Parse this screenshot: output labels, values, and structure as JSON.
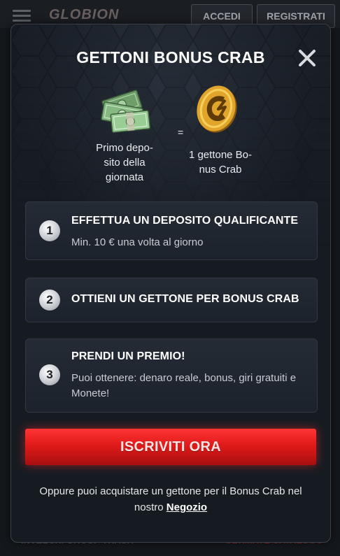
{
  "background": {
    "logo": "GLOBION",
    "login_label": "ACCEDI",
    "register_label": "REGISTRATI",
    "footer_left": "INVEECHI GHOUP TRASH",
    "footer_right": "ULTIMATE CATALOGO"
  },
  "modal": {
    "title": "GETTONI BONUS CRAB",
    "close_icon": "close-icon",
    "deposit_caption": "Primo depo-sito della giornata",
    "deposit_caption_lines": [
      "Primo depo-",
      "sito della",
      "giornata"
    ],
    "equals": "=",
    "token_caption_lines": [
      "1 gettone Bo-",
      "nus Crab"
    ],
    "steps": [
      {
        "number": "1",
        "title": "EFFETTUA UN DEPOSITO QUALIFICANTE",
        "desc": "Min. 10 € una volta al giorno"
      },
      {
        "number": "2",
        "title": "OTTIENI UN GETTONE PER BONUS CRAB",
        "desc": ""
      },
      {
        "number": "3",
        "title": "PRENDI UN PREMIO!",
        "desc": "Puoi ottenere: denaro reale, bonus, giri gratuiti e Monete!"
      }
    ],
    "cta_label": "ISCRIVITI ORA",
    "footer_text": "Oppure puoi acquistare un gettone per il Bonus Crab nel nostro",
    "footer_link": "Negozio"
  },
  "colors": {
    "cta": "#e01a1a",
    "coin": "#e0a52a",
    "money": "#8fbf8a"
  }
}
